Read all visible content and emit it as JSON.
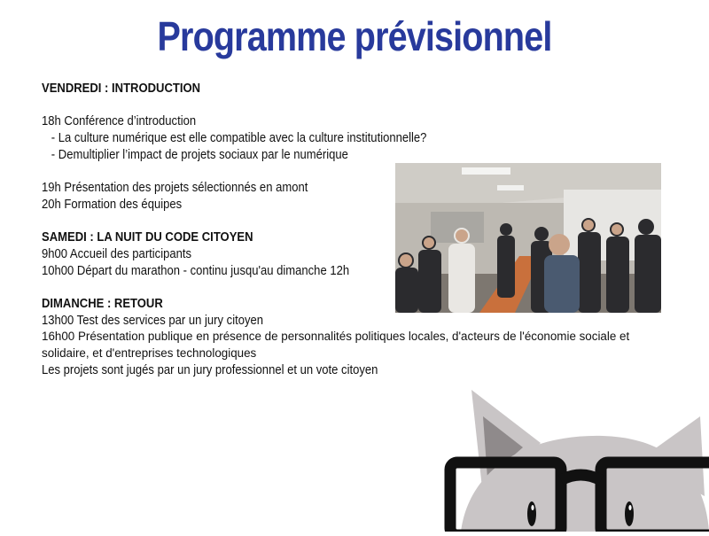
{
  "page": {
    "title": "Programme prévisionnel"
  },
  "program": {
    "friday": {
      "header": "VENDREDI : INTRODUCTION",
      "items": [
        "18h Conférence d’introduction",
        "- La culture numérique est elle compatible avec la culture institutionnelle?",
        "- Demultiplier l’impact de projets sociaux par le numérique",
        "19h Présentation des projets sélectionnés en amont",
        "20h Formation des équipes"
      ]
    },
    "saturday": {
      "header": "SAMEDI  : LA NUIT DU CODE CITOYEN",
      "items": [
        "9h00 Accueil des participants",
        "10h00 Départ du marathon - continu jusqu'au dimanche 12h"
      ]
    },
    "sunday": {
      "header": "DIMANCHE : RETOUR",
      "items": [
        "13h00 Test des services par un jury citoyen",
        "16h00 Présentation publique en présence de personnalités politiques locales, d'acteurs de l'économie sociale et solidaire, et d'entreprises technologiques",
        "Les projets sont jugés par un jury professionnel et un vote citoyen"
      ]
    }
  },
  "colors": {
    "title": "#283a9c",
    "text": "#111111",
    "mascot_fur": "#c9c5c6",
    "mascot_glasses": "#111111"
  },
  "icons": {
    "photo": "event-group-photo",
    "mascot": "cat-mascot-with-glasses"
  }
}
